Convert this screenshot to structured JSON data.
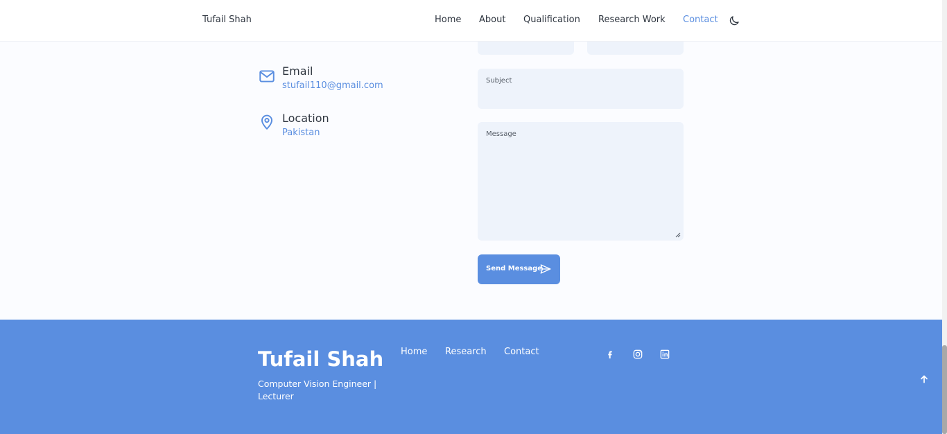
{
  "header": {
    "brand": "Tufail Shah",
    "nav": [
      {
        "label": "Home",
        "active": false
      },
      {
        "label": "About",
        "active": false
      },
      {
        "label": "Qualification",
        "active": false
      },
      {
        "label": "Research Work",
        "active": false
      },
      {
        "label": "Contact",
        "active": true
      }
    ],
    "theme_icon": "moon-icon"
  },
  "contact_info": {
    "email": {
      "title": "Email",
      "value": "stufail110@gmail.com",
      "icon": "mail-icon"
    },
    "location": {
      "title": "Location",
      "value": "Pakistan",
      "icon": "map-pin-icon"
    }
  },
  "form": {
    "subject_label": "Subject",
    "message_label": "Message",
    "send_label": "Send Message",
    "send_icon": "send-icon"
  },
  "footer": {
    "title": "Tufail Shah",
    "subtitle": "Computer Vision Engineer | Lecturer",
    "links": [
      "Home",
      "Research",
      "Contact"
    ],
    "social": [
      "facebook-icon",
      "instagram-icon",
      "linkedin-icon"
    ],
    "scroll_top_icon": "arrow-up-icon"
  },
  "colors": {
    "accent": "#5a8ee0",
    "background": "#fbfcff",
    "field_bg": "#eef3fb",
    "text": "#2f3640"
  }
}
